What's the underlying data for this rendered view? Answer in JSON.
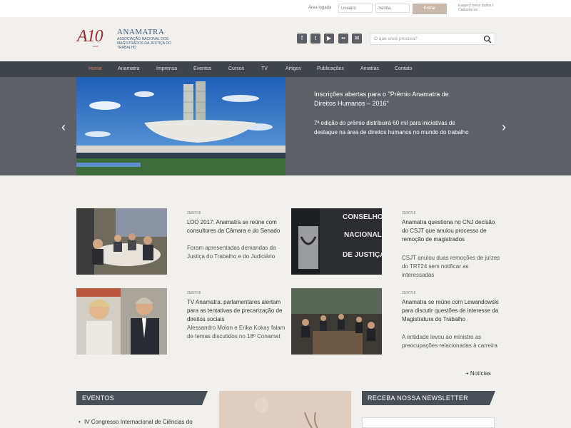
{
  "login": {
    "label": "Área logada",
    "user_placeholder": "Usuário",
    "pass_placeholder": "Senha",
    "enter_label": "Entrar",
    "forgot_label": "Esqueci meus dados / Cadastre-se"
  },
  "logo": {
    "mark": "A10",
    "mark_sub": "anos",
    "name": "ANAMATRA",
    "subtitle": "Associação Nacional dos Magistrados da Justiça do Trabalho"
  },
  "social": [
    {
      "icon": "facebook-icon",
      "glyph": "f"
    },
    {
      "icon": "twitter-icon",
      "glyph": "t"
    },
    {
      "icon": "youtube-icon",
      "glyph": "▶"
    },
    {
      "icon": "flickr-icon",
      "glyph": "••"
    },
    {
      "icon": "email-icon",
      "glyph": "✉"
    }
  ],
  "search": {
    "placeholder": "O que você procura?"
  },
  "nav": [
    {
      "label": "Home",
      "active": true
    },
    {
      "label": "Anamatra"
    },
    {
      "label": "Imprensa"
    },
    {
      "label": "Eventos"
    },
    {
      "label": "Cursos"
    },
    {
      "label": "TV"
    },
    {
      "label": "Artigos"
    },
    {
      "label": "Publicações"
    },
    {
      "label": "Amatras"
    },
    {
      "label": "Contato"
    }
  ],
  "slider": {
    "title": "Inscrições abertas para o \"Prêmio Anamatra de Direitos Humanos – 2016\"",
    "text": "7ª edição do prêmio distribuirá 60 mil para iniciativas de destaque na área de direitos humanos no mundo do trabalho"
  },
  "news": [
    {
      "date": "25/07/16",
      "title": "LDO 2017: Anamatra se reúne com consultores da Câmara e do Senado",
      "sub": "Foram apresentadas demandas da Justiça do Trabalho e do Judiciário"
    },
    {
      "date": "20/07/16",
      "title": "Anamatra questiona no CNJ decisão do CSJT que anulou processo de remoção de magistrados",
      "sub": "CSJT anulou duas remoções de juízes do TRT24 sem notificar as interessadas"
    },
    {
      "date": "25/07/16",
      "title": "TV Anamatra: parlamentares alertam para as tentativas de precarização de direitos sociais",
      "sub": "Alessandro Molon e Erika Kokay falam de temas discutidos no 18º Conamat"
    },
    {
      "date": "25/07/16",
      "title": "Anamatra se reúne com Lewandowski para discutir questões de interesse da Magistratura do Trabalho",
      "sub": "A entidade levou ao ministro as preocupações relacionadas à carreira"
    }
  ],
  "more_news": "+ Notícias",
  "events": {
    "heading": "EVENTOS",
    "first_item": "IV Congresso Internacional de Ciências do"
  },
  "newsletter": {
    "heading": "RECEBA NOSSA NEWSLETTER"
  },
  "colors": {
    "nav_bg": "#3f444b",
    "active": "#e07b55",
    "brand_red": "#9b2d28",
    "brand_blue": "#3a5b78"
  }
}
